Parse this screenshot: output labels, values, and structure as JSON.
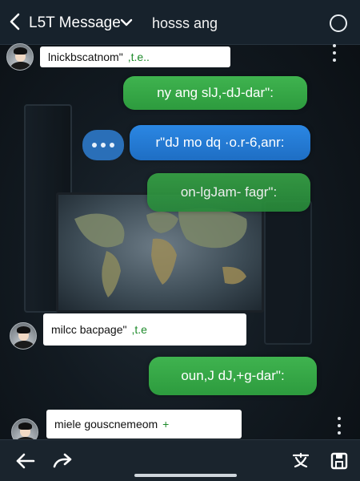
{
  "header": {
    "title": "L5T Message",
    "contact_name": "hosss ang"
  },
  "messages": [
    {
      "direction": "incoming",
      "text": "lnickbscatnom\"",
      "extra": ",t.e.."
    },
    {
      "direction": "outgoing",
      "color": "green",
      "text": "ny ang slJ,-dJ-dar\":"
    },
    {
      "direction": "outgoing",
      "color": "blue",
      "text": "r\"dJ mo dq ·o.r-6,anr:"
    },
    {
      "direction": "outgoing",
      "color": "green",
      "text": "on-lgJam- fagr\":"
    },
    {
      "direction": "incoming",
      "text": "milcc bacpage\"",
      "extra": ",t.e"
    },
    {
      "direction": "outgoing",
      "color": "green",
      "text": "oun,J dJ,+g-dar\":"
    },
    {
      "direction": "incoming",
      "text": "miele gouscnemeom",
      "extra": "+"
    }
  ],
  "icons": {
    "back": "chevron-left-icon",
    "dropdown": "chevron-down-icon",
    "info": "info-circle-icon",
    "reply": "reply-arrow-icon",
    "forward": "forward-arrow-icon",
    "translate": "translate-icon",
    "save": "save-icon"
  },
  "colors": {
    "header_bg": "#17222c",
    "outgoing_green": "#3fb34f",
    "outgoing_blue": "#2b87e3",
    "incoming_bg": "#ffffff"
  }
}
